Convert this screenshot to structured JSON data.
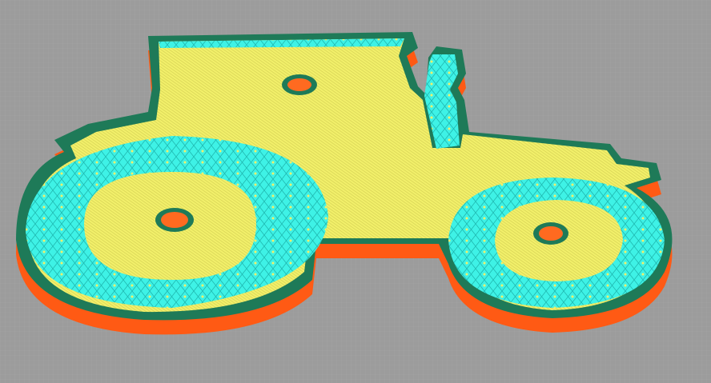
{
  "scene": {
    "colors": {
      "background": "#9c9c9c",
      "perimeter": "#ff5a14",
      "outline": "#1e7a58",
      "top_infill": "#f2f06a",
      "sparse_infill": "#3ef2e6",
      "hole": "#ff6a20"
    }
  }
}
